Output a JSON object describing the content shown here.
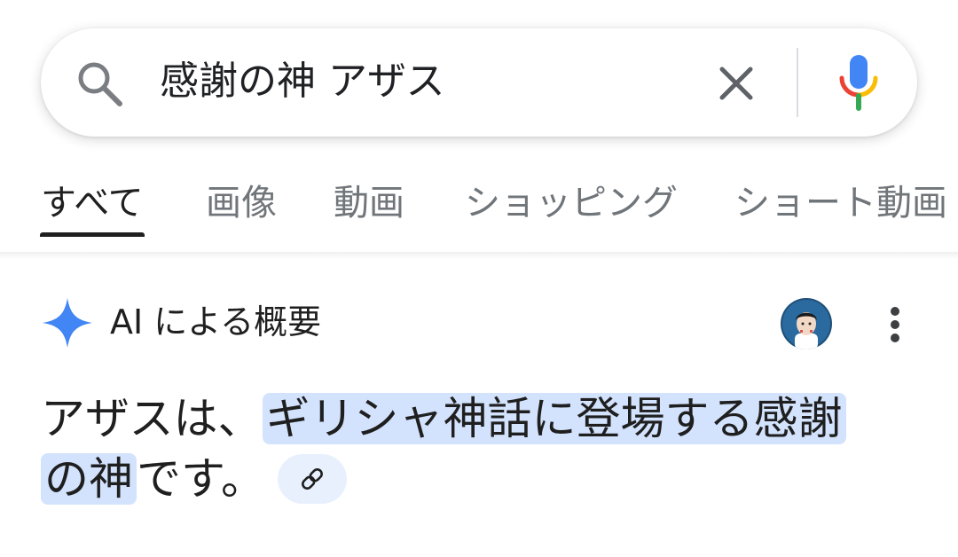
{
  "search": {
    "query": "感謝の神 アザス"
  },
  "tabs": [
    {
      "label": "すべて"
    },
    {
      "label": "画像"
    },
    {
      "label": "動画"
    },
    {
      "label": "ショッピング"
    },
    {
      "label": "ショート動画"
    }
  ],
  "ai_overview": {
    "title": "AI による概要",
    "answer_prefix": "アザスは、",
    "answer_highlight_1": "ギリシャ神話に登場する感謝",
    "answer_highlight_2": "の神",
    "answer_suffix": "です。"
  },
  "icons": {
    "search": "search-icon",
    "clear": "close-icon",
    "mic": "mic-icon",
    "sparkle": "sparkle-icon",
    "more": "more-vert-icon",
    "link": "link-icon"
  },
  "colors": {
    "highlight": "#d3e3fd",
    "sparkle": "#4285f4",
    "mic_blue": "#4285f4",
    "mic_red": "#ea4335",
    "mic_yellow": "#fbbc04",
    "mic_green": "#34a853"
  }
}
